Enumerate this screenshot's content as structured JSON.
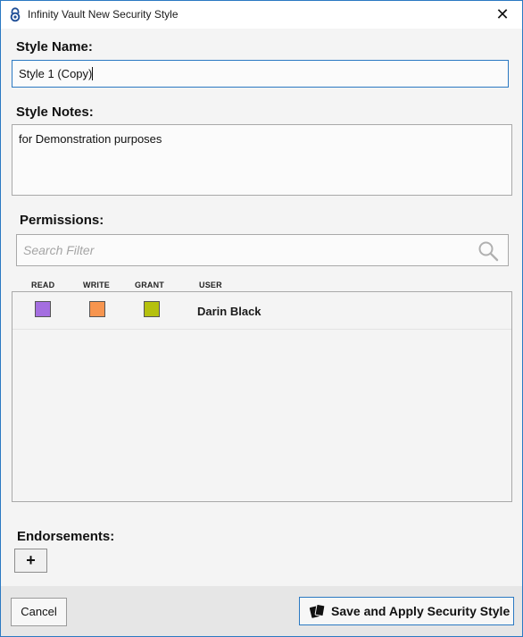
{
  "window": {
    "title": "Infinity Vault New Security Style",
    "close_glyph": "✕"
  },
  "style_name": {
    "label": "Style Name:",
    "value": "Style 1 (Copy)"
  },
  "style_notes": {
    "label": "Style Notes:",
    "value": "for Demonstration purposes"
  },
  "permissions": {
    "label": "Permissions:",
    "search_placeholder": "Search Filter",
    "columns": [
      "READ",
      "WRITE",
      "GRANT",
      "USER"
    ],
    "rows": [
      {
        "read_color": "#a46ee0",
        "write_color": "#f7954f",
        "grant_color": "#b5c10e",
        "user": "Darin Black"
      }
    ]
  },
  "endorsements": {
    "label": "Endorsements:",
    "add_label": "+"
  },
  "footer": {
    "cancel_label": "Cancel",
    "save_label": "Save and Apply Security Style"
  },
  "icons": {
    "app": "lock-icon",
    "search": "search-icon",
    "save": "cards-icon"
  },
  "colors": {
    "accent": "#2b79c2"
  }
}
